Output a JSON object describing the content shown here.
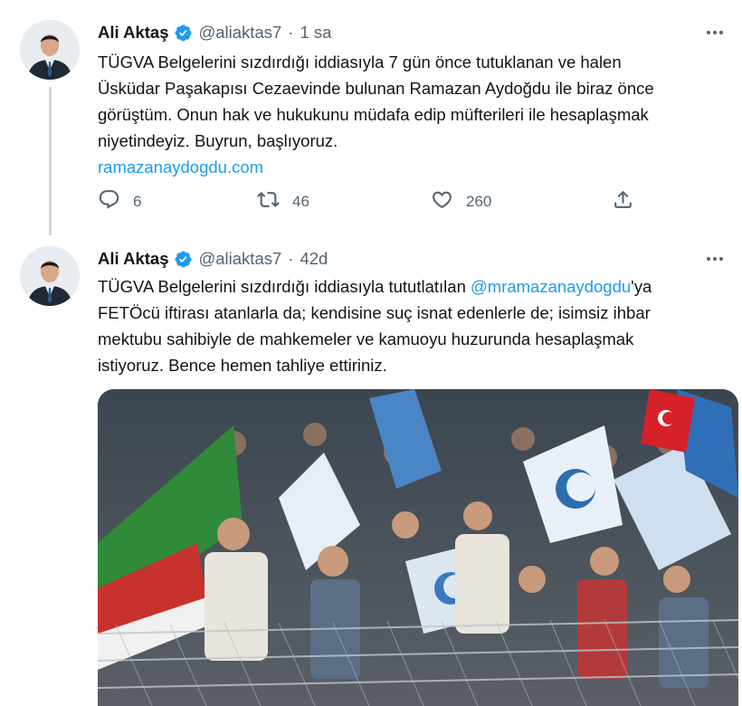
{
  "tweets": [
    {
      "name": "Ali Aktaş",
      "handle": "@aliaktas7",
      "separator": "·",
      "time": "1 sa",
      "text": "TÜGVA Belgelerini sızdırdığı iddiasıyla 7 gün önce tutuklanan ve halen\nÜsküdar Paşakapısı Cezaevinde bulunan Ramazan Aydoğdu ile biraz önce\ngörüştüm. Onun hak ve hukukunu müdafa edip müfterileri ile hesaplaşmak\nniyetindeyiz. Buyrun, başlıyoruz.",
      "link": "ramazanaydogdu.com",
      "replies": "6",
      "retweets": "46",
      "likes": "260"
    },
    {
      "name": "Ali Aktaş",
      "handle": "@aliaktas7",
      "separator": "·",
      "time": "42d",
      "text_before": "TÜGVA Belgelerini sızdırdığı iddiasıyla tututlatılan ",
      "mention": "@mramazanaydogdu",
      "text_after": "'ya\nFETÖcü iftirası atanlarla da; kendisine suç isnat edenlerle de; isimsiz ihbar\nmektubu sahibiyle de mahkemeler ve kamuoyu huzurunda hesaplaşmak\nistiyoruz. Bence hemen tahliye ettiriniz."
    }
  ],
  "icons": {
    "verified": "verified-badge-icon",
    "more": "more-icon",
    "reply": "reply-icon",
    "retweet": "retweet-icon",
    "like": "like-icon",
    "share": "share-icon"
  },
  "colors": {
    "link": "#1d9bf0",
    "verified": "#1d9bf0",
    "secondary_text": "#536471"
  }
}
